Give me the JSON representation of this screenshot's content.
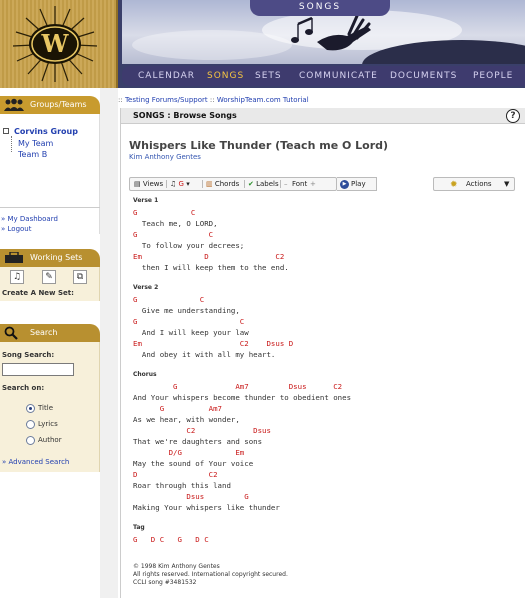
{
  "header": {
    "section_tab": "SONGS",
    "nav": [
      {
        "label": "CALENDAR",
        "active": false
      },
      {
        "label": "SONGS",
        "active": true
      },
      {
        "label": "SETS",
        "active": false
      },
      {
        "label": "COMMUNICATE",
        "active": false
      },
      {
        "label": "DOCUMENTS",
        "active": false
      },
      {
        "label": "PEOPLE",
        "active": false
      }
    ]
  },
  "sidebar": {
    "groups_title": "Groups/Teams",
    "group_name": "Corvins Group",
    "teams": [
      "My Team",
      "Team B"
    ],
    "dashboard_link": "» My Dashboard",
    "logout_link": "» Logout",
    "working_sets_title": "Working Sets",
    "create_set_label": "Create A New Set:",
    "search_title": "Search",
    "song_search_label": "Song Search:",
    "search_value": "",
    "search_on_label": "Search on:",
    "search_options": [
      "Title",
      "Lyrics",
      "Author"
    ],
    "selected_option": "Title",
    "advanced_search": "» Advanced Search"
  },
  "breadcrumb": {
    "prefix": "::",
    "items": [
      "Testing Forums/Support",
      "WorshipTeam.com Tutorial"
    ],
    "separator": "::"
  },
  "main": {
    "heading": "SONGS : Browse Songs",
    "help_label": "?",
    "song_title": "Whispers Like Thunder (Teach me O Lord)",
    "author": "Kim Anthony Gentes",
    "toolbar": {
      "views": "Views",
      "key": "G",
      "chords": "Chords",
      "labels": "Labels",
      "font_minus": "–",
      "font": "Font",
      "font_plus": "+",
      "play": "Play"
    },
    "actions": "Actions",
    "sheet": [
      {
        "type": "section",
        "text": "Verse 1"
      },
      {
        "type": "chord",
        "text": "G            C"
      },
      {
        "type": "lyric",
        "text": "  Teach me, O LORD,"
      },
      {
        "type": "chord",
        "text": "G                C"
      },
      {
        "type": "lyric",
        "text": "  To follow your decrees;"
      },
      {
        "type": "chord",
        "text": "Em              D               C2"
      },
      {
        "type": "lyric",
        "text": "  then I will keep them to the end."
      },
      {
        "type": "gap",
        "text": ""
      },
      {
        "type": "section",
        "text": "Verse 2"
      },
      {
        "type": "chord",
        "text": "G              C"
      },
      {
        "type": "lyric",
        "text": "  Give me understanding,"
      },
      {
        "type": "chord",
        "text": "G                       C"
      },
      {
        "type": "lyric",
        "text": "  And I will keep your law"
      },
      {
        "type": "chord",
        "text": "Em                      C2    Dsus D"
      },
      {
        "type": "lyric",
        "text": "  And obey it with all my heart."
      },
      {
        "type": "gap",
        "text": ""
      },
      {
        "type": "section",
        "text": "Chorus"
      },
      {
        "type": "chord",
        "text": "         G             Am7         Dsus      C2"
      },
      {
        "type": "lyric",
        "text": "And Your whispers become thunder to obedient ones"
      },
      {
        "type": "chord",
        "text": "      G          Am7"
      },
      {
        "type": "lyric",
        "text": "As we hear, with wonder,"
      },
      {
        "type": "chord",
        "text": "            C2             Dsus"
      },
      {
        "type": "lyric",
        "text": "That we're daughters and sons"
      },
      {
        "type": "chord",
        "text": "        D/G            Em"
      },
      {
        "type": "lyric",
        "text": "May the sound of Your voice"
      },
      {
        "type": "chord",
        "text": "D                C2"
      },
      {
        "type": "lyric",
        "text": "Roar through this land"
      },
      {
        "type": "chord",
        "text": "            Dsus         G"
      },
      {
        "type": "lyric",
        "text": "Making Your whispers like thunder"
      },
      {
        "type": "gap",
        "text": ""
      },
      {
        "type": "section",
        "text": "Tag"
      },
      {
        "type": "chord",
        "text": "G   D C   G   D C"
      }
    ],
    "copyright": [
      "© 1998 Kim Anthony Gentes",
      "All rights reserved. International copyright secured.",
      "CCLI song #3481532"
    ]
  },
  "colors": {
    "nav_bg": "#3e3b6e",
    "nav_active": "#f5c542",
    "sidebar_gold": "#c89b2e",
    "chord_red": "#c91818",
    "link_blue": "#2340b0"
  }
}
